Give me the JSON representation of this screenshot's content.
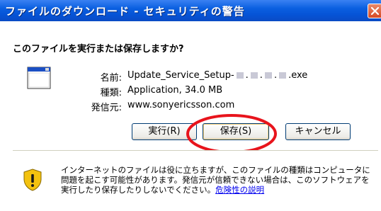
{
  "window": {
    "title": "ファイルのダウンロード - セキュリティの警告"
  },
  "dialog": {
    "question": "このファイルを実行または保存しますか?"
  },
  "file": {
    "name_label": "名前:",
    "name_prefix": "Update_Service_Setup-",
    "name_suffix": ".exe",
    "type_label": "種類:",
    "type_value": "Application, 34.0 MB",
    "publisher_label": "発信元:",
    "publisher_value": "www.sonyericsson.com"
  },
  "buttons": {
    "run": "実行(R)",
    "save": "保存(S)",
    "cancel": "キャンセル"
  },
  "warning": {
    "text": "インターネットのファイルは役に立ちますが、このファイルの種類はコンピュータに問題を起こす可能性があります。発信元が信頼できない場合は、このソフトウェアを実行したり保存したりしないでください。",
    "link": "危険性の説明"
  },
  "colors": {
    "highlight": "#e8141c",
    "titlebar": "#0653d6",
    "close": "#d64a24",
    "link": "#0000ee"
  },
  "icons": {
    "close": "close-icon",
    "app": "application-icon",
    "warning": "shield-warning-icon"
  }
}
